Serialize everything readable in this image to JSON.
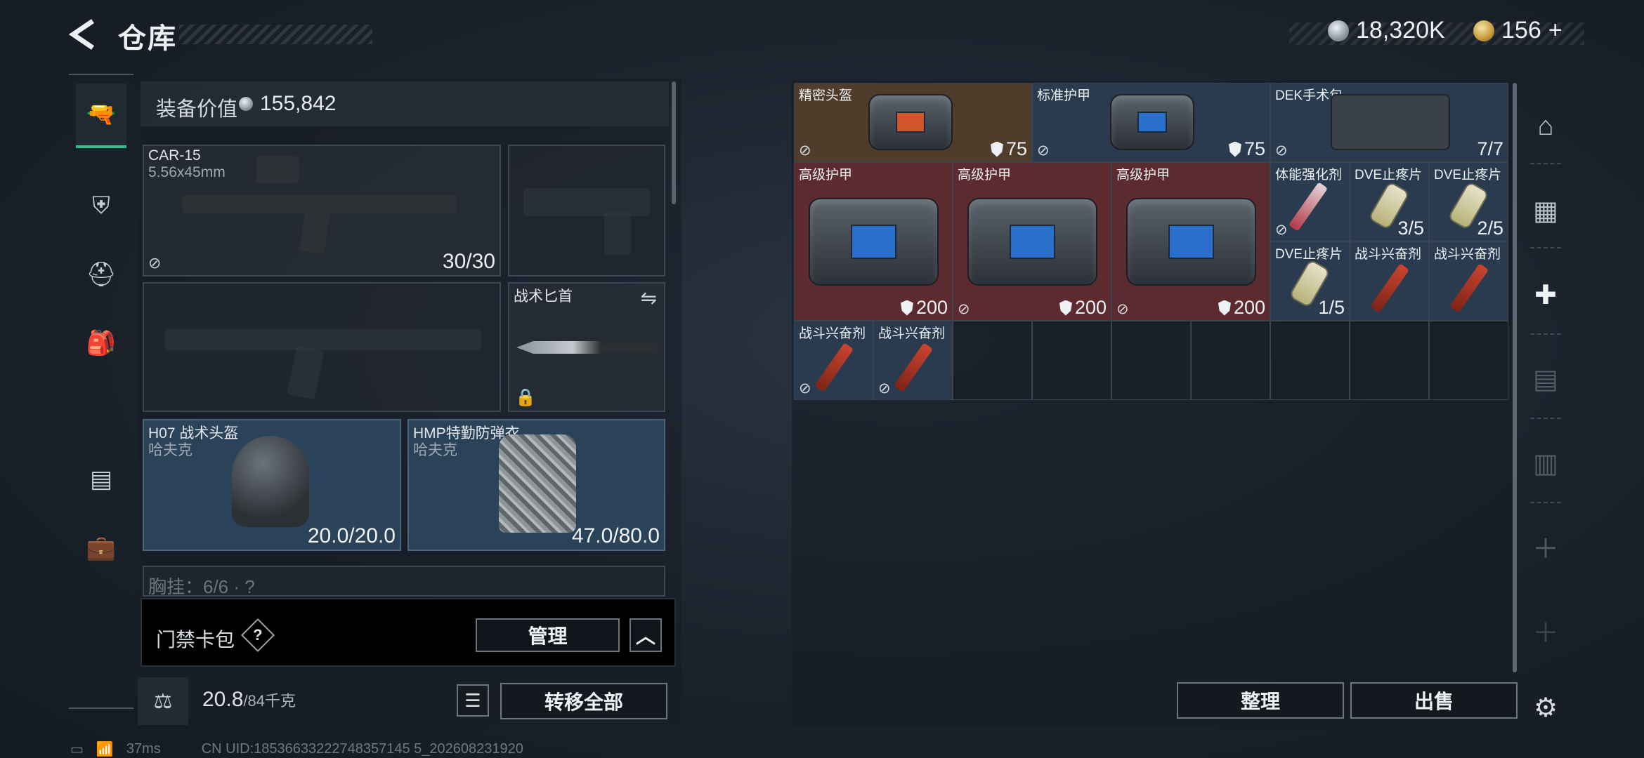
{
  "header": {
    "title": "仓库",
    "currency_silver": "18,320K",
    "currency_gold": "156",
    "currency_gold_plus": "+"
  },
  "equipment": {
    "value_label": "装备价值",
    "value": "155,842"
  },
  "slots": {
    "primary": {
      "name": "CAR-15",
      "caliber": "5.56x45mm",
      "ammo": "30/30"
    },
    "melee": {
      "name": "战术匕首"
    },
    "helmet": {
      "name": "H07 战术头盔",
      "sub": "哈夫克",
      "durability": "20.0/20.0"
    },
    "armor": {
      "name": "HMP特勤防弹衣",
      "sub": "哈夫克",
      "durability": "47.0/80.0"
    },
    "chest_partial": "胸挂：6/6 · ?"
  },
  "keycard": {
    "label": "门禁卡包",
    "help": "?",
    "manage": "管理"
  },
  "bottom": {
    "weight": "20.8",
    "weight_max": "/84千克",
    "transfer": "转移全部",
    "sort": "整理",
    "sell": "出售"
  },
  "status": {
    "ping": "37ms",
    "uid": "CN UID:18536633222748357145 5_202608231920"
  },
  "stash": [
    {
      "name": "精密头盔",
      "value": "75"
    },
    {
      "name": "标准护甲",
      "value": "75"
    },
    {
      "name": "DEK手术包",
      "value": "7/7"
    },
    {
      "name": "高级护甲",
      "value": "200"
    },
    {
      "name": "高级护甲",
      "value": "200"
    },
    {
      "name": "高级护甲",
      "value": "200"
    },
    {
      "name": "体能强化剂",
      "value": ""
    },
    {
      "name": "DVE止疼片",
      "value": "3/5"
    },
    {
      "name": "DVE止疼片",
      "value": "2/5"
    },
    {
      "name": "DVE止疼片",
      "value": "1/5"
    },
    {
      "name": "战斗兴奋剂",
      "value": ""
    },
    {
      "name": "战斗兴奋剂",
      "value": ""
    },
    {
      "name": "战斗兴奋剂",
      "value": ""
    },
    {
      "name": "战斗兴奋剂",
      "value": ""
    }
  ],
  "colors": {
    "accent": "#2fc08a",
    "rarity_red": "#5b2b30",
    "rarity_blue": "#2a3b4f",
    "rarity_gold": "#4f3c2b"
  }
}
